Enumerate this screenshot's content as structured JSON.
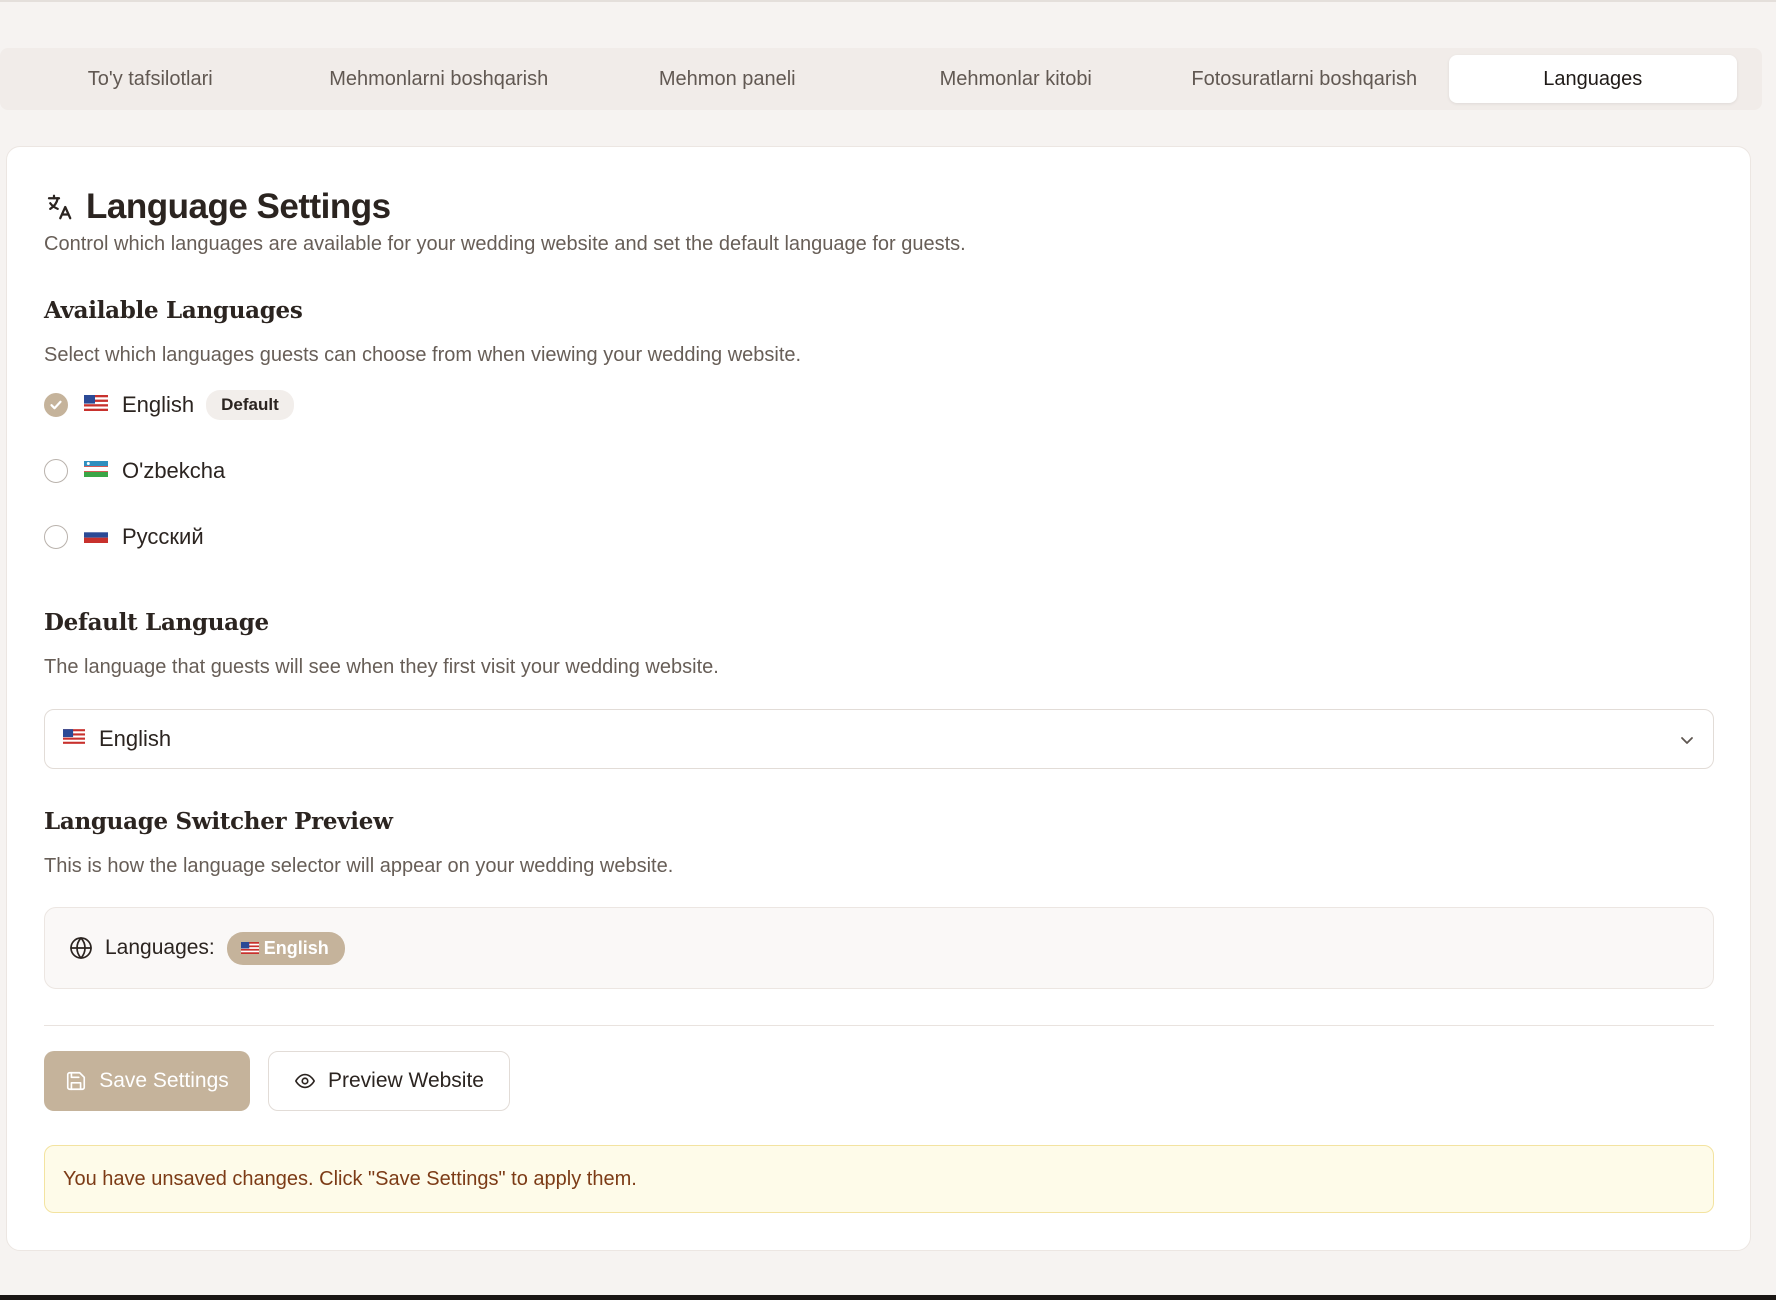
{
  "tabs": [
    {
      "label": "To'y tafsilotlari",
      "active": false
    },
    {
      "label": "Mehmonlarni boshqarish",
      "active": false
    },
    {
      "label": "Mehmon paneli",
      "active": false
    },
    {
      "label": "Mehmonlar kitobi",
      "active": false
    },
    {
      "label": "Fotosuratlarni boshqarish",
      "active": false
    },
    {
      "label": "Languages",
      "active": true
    }
  ],
  "header": {
    "title": "Language Settings",
    "subtitle": "Control which languages are available for your wedding website and set the default language for guests.",
    "icon": "translate-icon"
  },
  "available": {
    "title": "Available Languages",
    "description": "Select which languages guests can choose from when viewing your wedding website.",
    "languages": [
      {
        "label": "English",
        "flag": "us-flag",
        "checked": true,
        "badge": "Default"
      },
      {
        "label": "O'zbekcha",
        "flag": "uz-flag",
        "checked": false
      },
      {
        "label": "Русский",
        "flag": "ru-flag",
        "checked": false
      }
    ]
  },
  "default_language": {
    "title": "Default Language",
    "description": "The language that guests will see when they first visit your wedding website.",
    "selected": "English",
    "selected_flag": "us-flag"
  },
  "switcher_preview": {
    "title": "Language Switcher Preview",
    "description": "This is how the language selector will appear on your wedding website.",
    "label": "Languages:",
    "pill": "English",
    "pill_flag": "us-flag"
  },
  "actions": {
    "save_label": "Save Settings",
    "preview_label": "Preview Website"
  },
  "notice": "You have unsaved changes. Click \"Save Settings\" to apply them.",
  "colors": {
    "accent": "#c5b39b",
    "notice_bg": "#fefbe9",
    "notice_text": "#7c3b16"
  }
}
